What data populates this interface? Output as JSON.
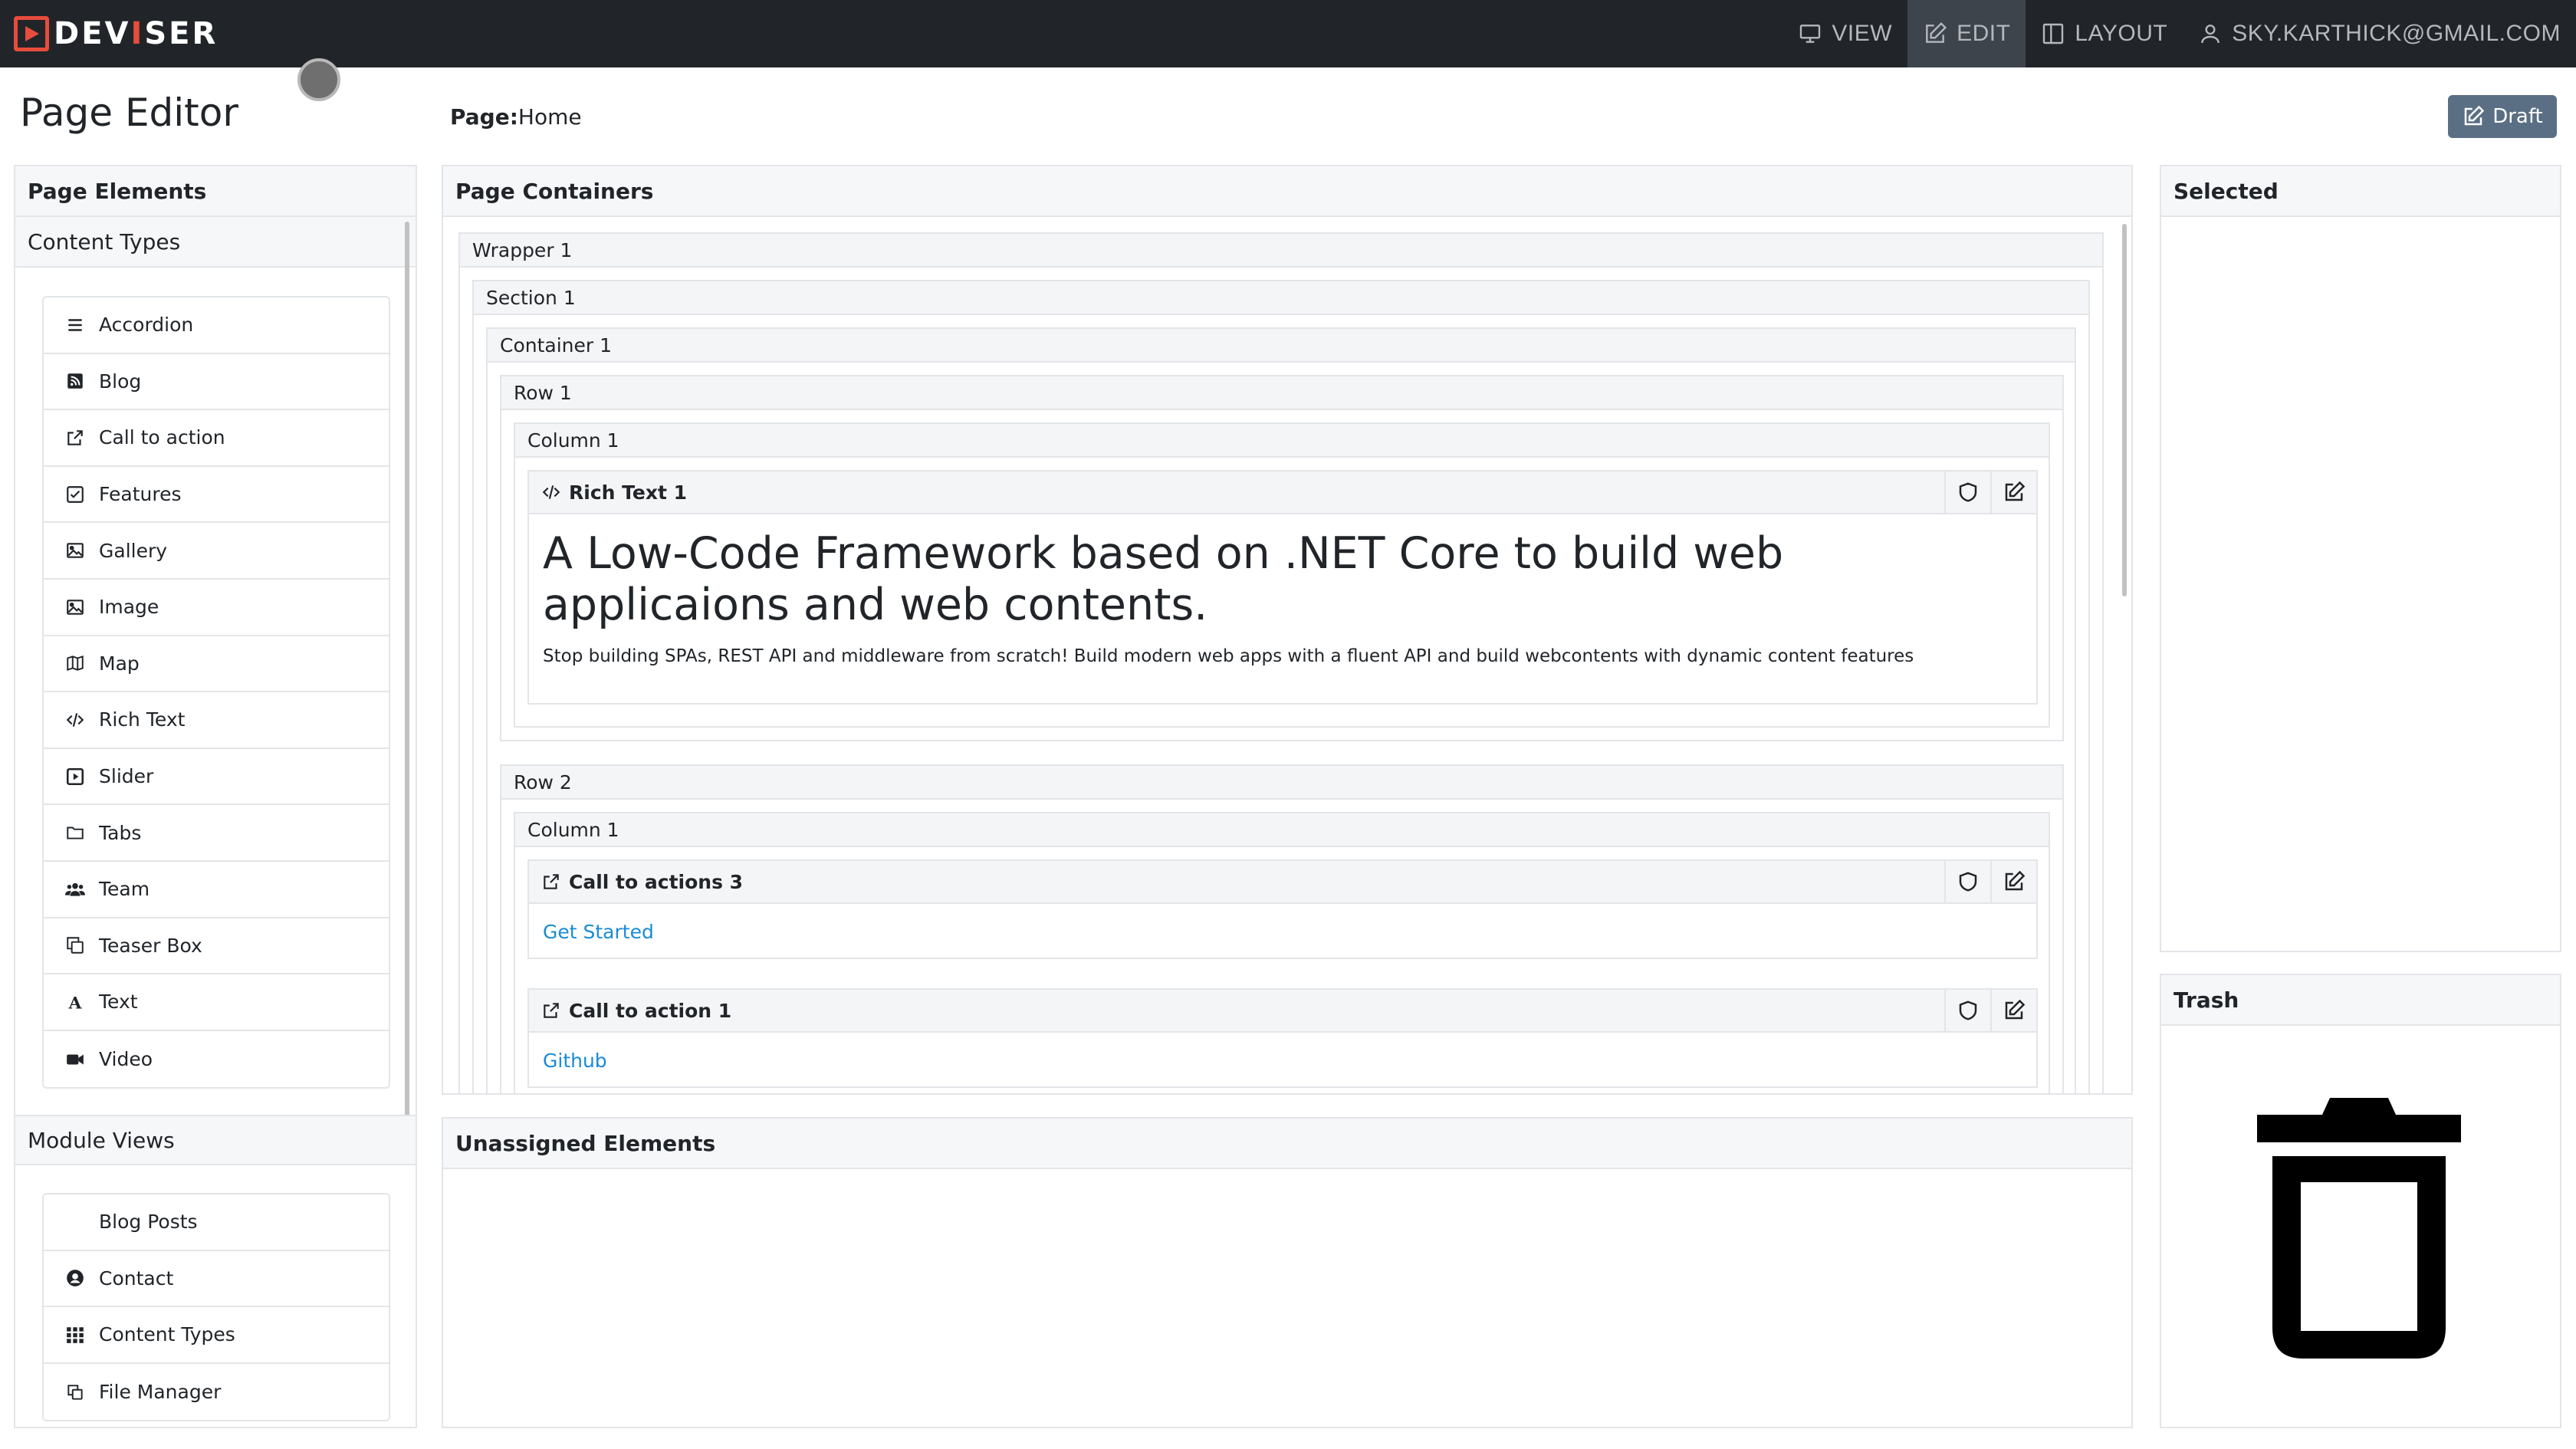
{
  "brand": {
    "pre": "DEV",
    "accent": "I",
    "post": "SER"
  },
  "nav": {
    "view": "VIEW",
    "edit": "EDIT",
    "layout": "LAYOUT",
    "user": "SKY.KARTHICK@GMAIL.COM"
  },
  "header": {
    "title": "Page Editor",
    "page_label": "Page:",
    "page_name": "Home",
    "draft_label": "Draft"
  },
  "left": {
    "title": "Page Elements",
    "content_types_title": "Content Types",
    "content_types": [
      {
        "label": "Accordion",
        "icon": "bars-icon"
      },
      {
        "label": "Blog",
        "icon": "rss-icon"
      },
      {
        "label": "Call to action",
        "icon": "external-link-icon"
      },
      {
        "label": "Features",
        "icon": "check-square-icon"
      },
      {
        "label": "Gallery",
        "icon": "image-icon"
      },
      {
        "label": "Image",
        "icon": "image-icon"
      },
      {
        "label": "Map",
        "icon": "map-icon"
      },
      {
        "label": "Rich Text",
        "icon": "code-icon"
      },
      {
        "label": "Slider",
        "icon": "play-square-icon"
      },
      {
        "label": "Tabs",
        "icon": "folder-icon"
      },
      {
        "label": "Team",
        "icon": "users-icon"
      },
      {
        "label": "Teaser Box",
        "icon": "clone-icon"
      },
      {
        "label": "Text",
        "icon": "font-icon"
      },
      {
        "label": "Video",
        "icon": "video-camera-icon"
      }
    ],
    "module_views_title": "Module Views",
    "module_views": [
      {
        "label": "Blog Posts",
        "icon": ""
      },
      {
        "label": "Contact",
        "icon": "user-circle-icon"
      },
      {
        "label": "Content Types",
        "icon": "grid-icon"
      },
      {
        "label": "File Manager",
        "icon": "copy-icon"
      }
    ]
  },
  "center": {
    "title": "Page Containers",
    "wrapper": "Wrapper 1",
    "section": "Section 1",
    "container": "Container 1",
    "row1": "Row 1",
    "row1_column": "Column 1",
    "rich_text": {
      "title": "Rich Text 1",
      "heading": "A Low-Code Framework based on .NET Core to build web applicaions and web contents.",
      "description": "Stop building SPAs, REST API and middleware from scratch! Build modern web apps with a fluent API and build webcontents with dynamic content features"
    },
    "row2": "Row 2",
    "row2_column": "Column 1",
    "cta3": {
      "title": "Call to actions 3",
      "link": "Get Started"
    },
    "cta1": {
      "title": "Call to action 1",
      "link": "Github"
    }
  },
  "unassigned": {
    "title": "Unassigned Elements"
  },
  "selected": {
    "title": "Selected"
  },
  "trash": {
    "title": "Trash"
  },
  "colors": {
    "nav_bg": "#212529",
    "brand_red": "#e74c3c",
    "link_blue": "#1a8bd6",
    "draft_btn": "#5a6f84"
  }
}
